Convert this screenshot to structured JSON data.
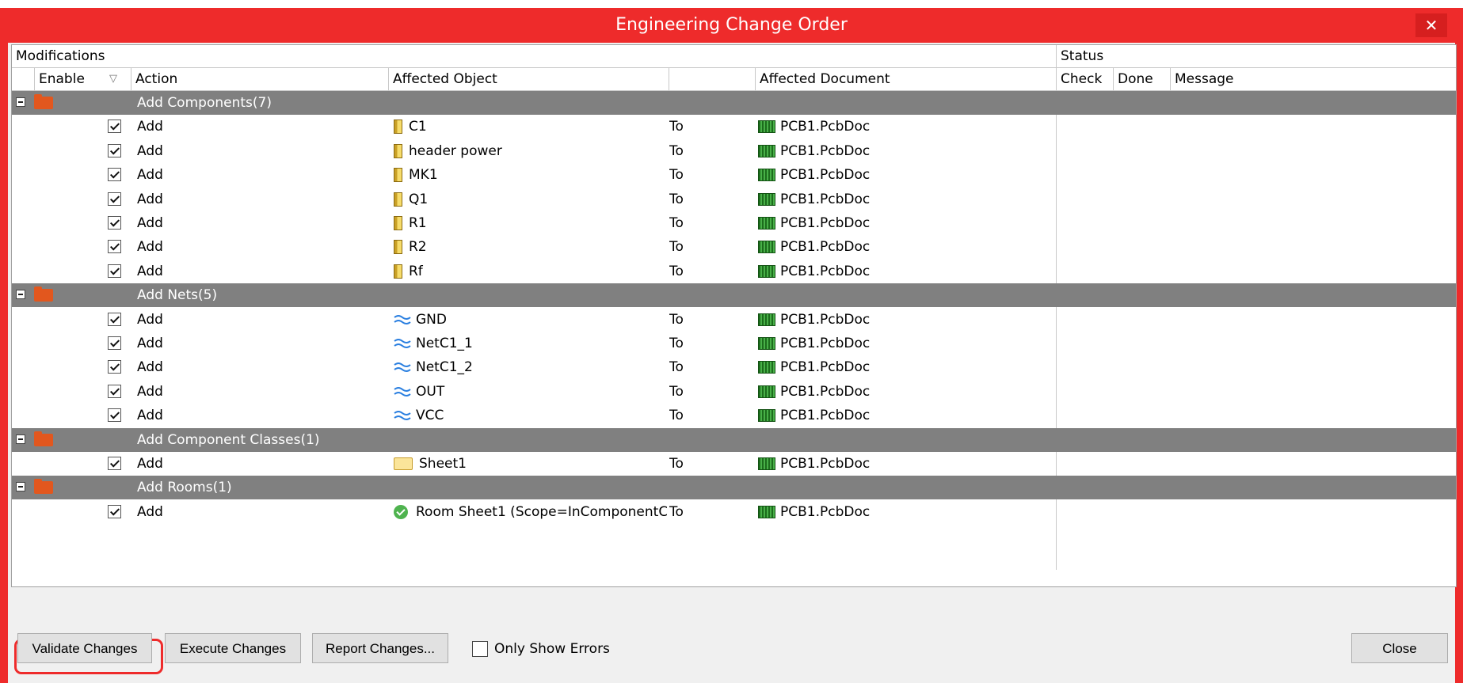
{
  "window": {
    "title": "Engineering Change Order",
    "close_glyph": "✕"
  },
  "header": {
    "group1": "Modifications",
    "group2": "Status",
    "enable": "Enable",
    "sort_glyph": "▽",
    "action": "Action",
    "affected_object": "Affected Object",
    "affected_document": "Affected Document",
    "check": "Check",
    "done": "Done",
    "message": "Message"
  },
  "rows": [
    {
      "type": "group",
      "label": "Add Components(7)"
    },
    {
      "type": "item",
      "action": "Add",
      "icon": "component",
      "object": "C1",
      "to": "To",
      "document": "PCB1.PcbDoc"
    },
    {
      "type": "item",
      "action": "Add",
      "icon": "component",
      "object": "header power",
      "to": "To",
      "document": "PCB1.PcbDoc"
    },
    {
      "type": "item",
      "action": "Add",
      "icon": "component",
      "object": "MK1",
      "to": "To",
      "document": "PCB1.PcbDoc"
    },
    {
      "type": "item",
      "action": "Add",
      "icon": "component",
      "object": "Q1",
      "to": "To",
      "document": "PCB1.PcbDoc"
    },
    {
      "type": "item",
      "action": "Add",
      "icon": "component",
      "object": "R1",
      "to": "To",
      "document": "PCB1.PcbDoc"
    },
    {
      "type": "item",
      "action": "Add",
      "icon": "component",
      "object": "R2",
      "to": "To",
      "document": "PCB1.PcbDoc"
    },
    {
      "type": "item",
      "action": "Add",
      "icon": "component",
      "object": "Rf",
      "to": "To",
      "document": "PCB1.PcbDoc"
    },
    {
      "type": "group",
      "label": "Add Nets(5)"
    },
    {
      "type": "item",
      "action": "Add",
      "icon": "net",
      "object": "GND",
      "to": "To",
      "document": "PCB1.PcbDoc"
    },
    {
      "type": "item",
      "action": "Add",
      "icon": "net",
      "object": "NetC1_1",
      "to": "To",
      "document": "PCB1.PcbDoc"
    },
    {
      "type": "item",
      "action": "Add",
      "icon": "net",
      "object": "NetC1_2",
      "to": "To",
      "document": "PCB1.PcbDoc"
    },
    {
      "type": "item",
      "action": "Add",
      "icon": "net",
      "object": "OUT",
      "to": "To",
      "document": "PCB1.PcbDoc"
    },
    {
      "type": "item",
      "action": "Add",
      "icon": "net",
      "object": "VCC",
      "to": "To",
      "document": "PCB1.PcbDoc"
    },
    {
      "type": "group",
      "label": "Add Component Classes(1)"
    },
    {
      "type": "item",
      "action": "Add",
      "icon": "folder",
      "object": "Sheet1",
      "to": "To",
      "document": "PCB1.PcbDoc"
    },
    {
      "type": "group",
      "label": "Add Rooms(1)"
    },
    {
      "type": "item",
      "action": "Add",
      "icon": "room",
      "object": "Room Sheet1 (Scope=InComponentCl",
      "to": "To",
      "document": "PCB1.PcbDoc"
    }
  ],
  "footer": {
    "validate": "Validate Changes",
    "execute": "Execute Changes",
    "report": "Report Changes...",
    "only_errors": "Only Show Errors",
    "close": "Close"
  }
}
